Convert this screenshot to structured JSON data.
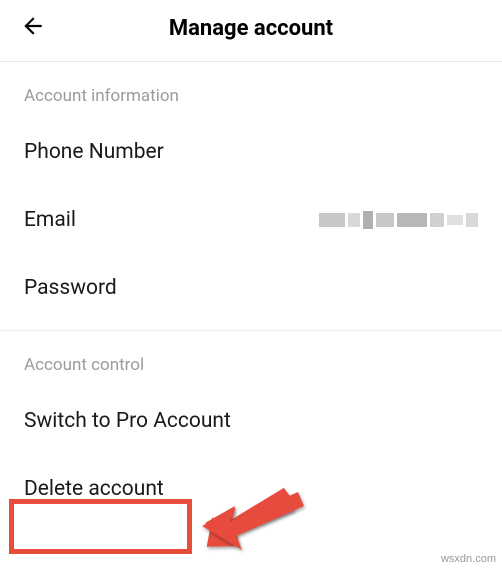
{
  "header": {
    "title": "Manage account"
  },
  "sections": {
    "info": {
      "header": "Account information",
      "phone": "Phone Number",
      "email": "Email",
      "password": "Password"
    },
    "control": {
      "header": "Account control",
      "switch_pro": "Switch to Pro Account",
      "delete": "Delete account"
    }
  },
  "watermark": "wsxdn.com"
}
